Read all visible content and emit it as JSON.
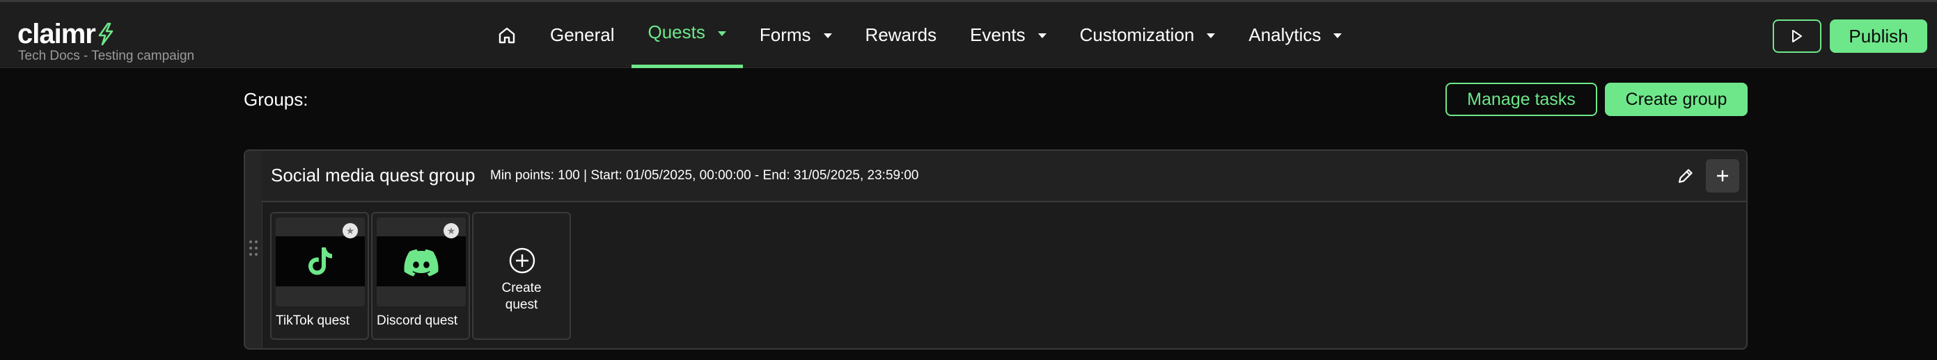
{
  "app": {
    "logo_text": "claimr",
    "campaign": "Tech Docs - Testing campaign"
  },
  "nav": {
    "items": [
      {
        "label": "General"
      },
      {
        "label": "Quests",
        "active": true
      },
      {
        "label": "Forms"
      },
      {
        "label": "Rewards"
      },
      {
        "label": "Events"
      },
      {
        "label": "Customization"
      },
      {
        "label": "Analytics"
      }
    ],
    "publish_label": "Publish"
  },
  "groups": {
    "label": "Groups:",
    "manage_label": "Manage tasks",
    "create_label": "Create group",
    "list": [
      {
        "title": "Social media quest group",
        "meta": "Min points: 100 | Start: 01/05/2025, 00:00:00 - End: 31/05/2025, 23:59:00",
        "quests": [
          {
            "label": "TikTok quest",
            "icon": "tiktok-icon"
          },
          {
            "label": "Discord quest",
            "icon": "discord-icon"
          }
        ],
        "create_quest_label_1": "Create",
        "create_quest_label_2": "quest"
      }
    ]
  },
  "colors": {
    "accent": "#6ee78a",
    "background": "#0b0b0b",
    "topbar": "#1e1e1e",
    "card": "#1c1c1c"
  }
}
